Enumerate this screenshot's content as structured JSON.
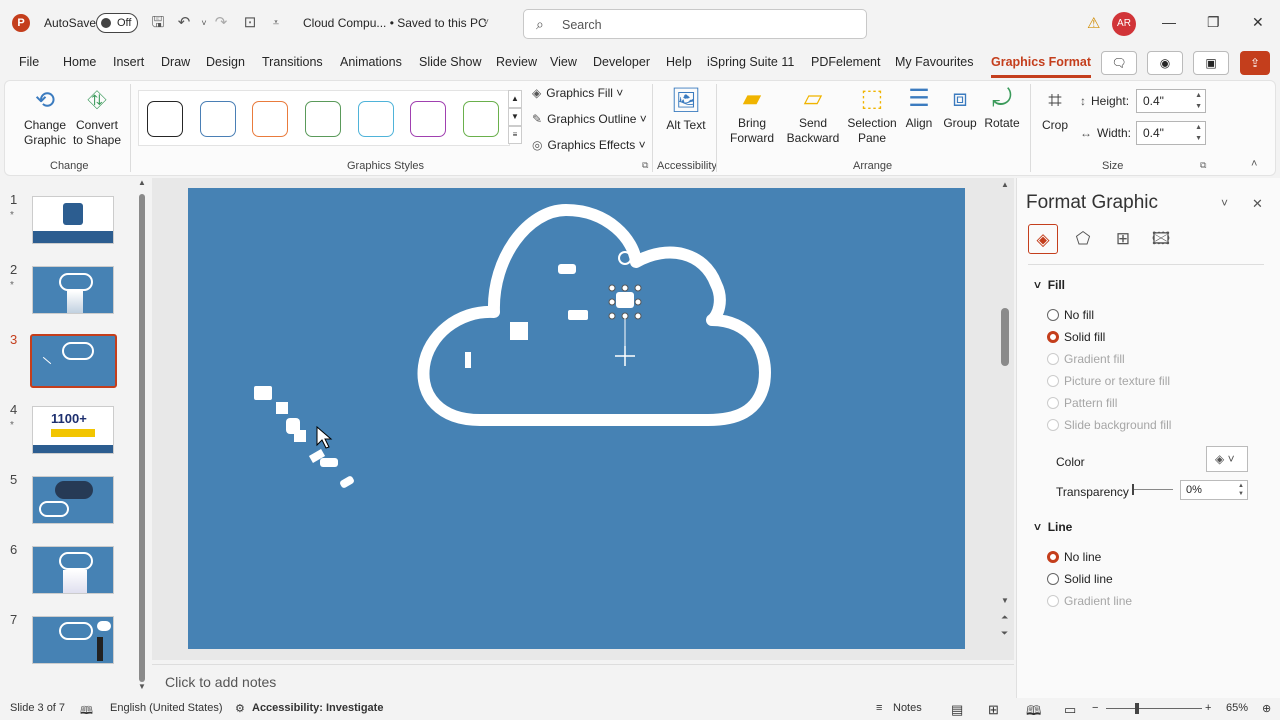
{
  "titlebar": {
    "app_logo": "P",
    "autosave_label": "AutoSave",
    "autosave_state": "Off",
    "doc_title": "Cloud Compu... • Saved to this PC",
    "search_placeholder": "Search",
    "user_initials": "AR"
  },
  "tabs": [
    "File",
    "Home",
    "Insert",
    "Draw",
    "Design",
    "Transitions",
    "Animations",
    "Slide Show",
    "Review",
    "View",
    "Developer",
    "Help",
    "iSpring Suite 11",
    "PDFelement",
    "My Favourites",
    "Graphics Format"
  ],
  "active_tab": "Graphics Format",
  "ribbon": {
    "change": {
      "change_graphic": "Change Graphic",
      "convert_to_shape": "Convert to Shape",
      "group_label": "Change"
    },
    "styles": {
      "group_label": "Graphics Styles",
      "swatch_colors": [
        "#262626",
        "#4a7fb5",
        "#e97b3c",
        "#5a9a5a",
        "#4fb3d9",
        "#a040b0",
        "#6ab04c"
      ],
      "graphics_fill": "Graphics Fill",
      "graphics_outline": "Graphics Outline",
      "graphics_effects": "Graphics Effects"
    },
    "accessibility": {
      "alt_text": "Alt Text",
      "group_label": "Accessibility"
    },
    "arrange": {
      "bring_forward": "Bring Forward",
      "send_backward": "Send Backward",
      "selection_pane": "Selection Pane",
      "align": "Align",
      "group": "Group",
      "rotate": "Rotate",
      "group_label": "Arrange"
    },
    "size": {
      "crop": "Crop",
      "height_label": "Height:",
      "height_value": "0.4\"",
      "width_label": "Width:",
      "width_value": "0.4\"",
      "group_label": "Size"
    }
  },
  "thumbnails": [
    {
      "num": "1",
      "star": "*"
    },
    {
      "num": "2",
      "star": "*"
    },
    {
      "num": "3",
      "star": ""
    },
    {
      "num": "4",
      "star": "*"
    },
    {
      "num": "5",
      "star": ""
    },
    {
      "num": "6",
      "star": ""
    },
    {
      "num": "7",
      "star": ""
    }
  ],
  "thumb4_text": "1100+",
  "notes_placeholder": "Click to add notes",
  "slide_bg": "#4682b4",
  "format_pane": {
    "title": "Format Graphic",
    "fill_heading": "Fill",
    "fill_options": [
      "No fill",
      "Solid fill",
      "Gradient fill",
      "Picture or texture fill",
      "Pattern fill",
      "Slide background fill"
    ],
    "color_label": "Color",
    "transparency_label": "Transparency",
    "transparency_value": "0%",
    "line_heading": "Line",
    "line_options": [
      "No line",
      "Solid line",
      "Gradient line"
    ]
  },
  "statusbar": {
    "slide_info": "Slide 3 of 7",
    "language": "English (United States)",
    "accessibility": "Accessibility: Investigate",
    "notes": "Notes",
    "zoom": "65%"
  },
  "accent": "#c43e1c"
}
